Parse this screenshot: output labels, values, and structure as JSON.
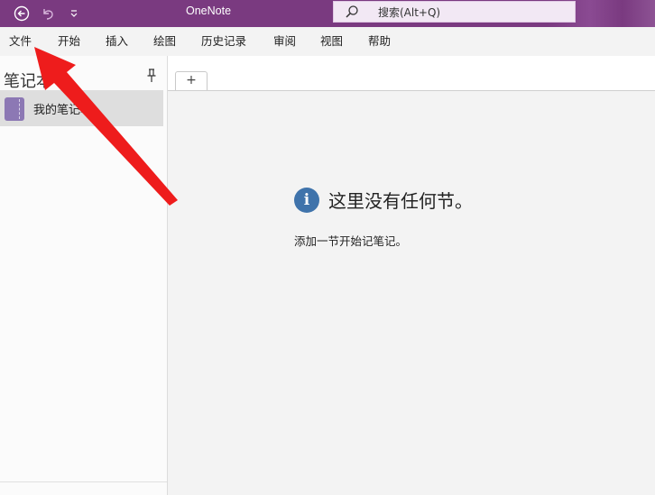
{
  "titlebar": {
    "app_title": "OneNote",
    "search_placeholder": "搜索(Alt+Q)"
  },
  "menu": {
    "items": [
      "文件",
      "开始",
      "插入",
      "绘图",
      "历史记录",
      "审阅",
      "视图",
      "帮助"
    ]
  },
  "notebook_pane": {
    "header": "笔记本",
    "notebooks": [
      {
        "label": "我的笔记本",
        "color": "#8c78b4"
      }
    ]
  },
  "tabs": {
    "add_label": "+"
  },
  "empty_state": {
    "title": "这里没有任何节。",
    "subtitle": "添加一节开始记笔记。"
  },
  "colors": {
    "titlebar": "#7a3a80",
    "annotation_arrow": "#ee1c1c",
    "info_icon": "#3f73ab"
  }
}
